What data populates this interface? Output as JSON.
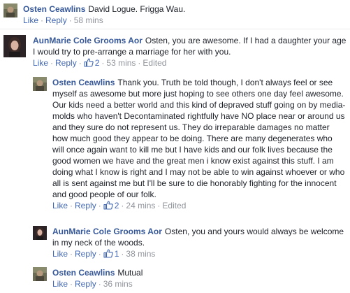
{
  "comments": [
    {
      "author": "Osten Ceawlins",
      "text": "David Logue. Frigga Wau.",
      "actions": {
        "like": "Like",
        "reply": "Reply",
        "time": "58 mins"
      }
    },
    {
      "author": "AunMarie Cole Grooms Aor",
      "text": "Osten, you are awesome. If I had a daughter your age I would try to pre-arrange a marriage for her with you.",
      "actions": {
        "like": "Like",
        "reply": "Reply",
        "likes": "2",
        "time": "53 mins",
        "edited": "Edited"
      }
    },
    {
      "author": "Osten Ceawlins",
      "text": "Thank you. Truth be told though, I don't always feel or see myself as awesome but more just hoping to see others one day feel awesome. Our kids need a better world and this kind of depraved stuff going on by media-molds who haven't Decontaminated rightfully have NO place near or around us and they sure do not represent us. They do irreparable damages no matter how much good they appear to be doing. There are many degenerates who will once again want to kill me but I have kids and our folk lives because the good women we have and the great men i know exist against this stuff. I am doing what I know is right and I may not be able to win against whoever or who all is sent against me but I'll be sure to die honorably fighting for the innocent and good people of our folk.",
      "actions": {
        "like": "Like",
        "reply": "Reply",
        "likes": "2",
        "time": "24 mins",
        "edited": "Edited"
      }
    },
    {
      "author": "AunMarie Cole Grooms Aor",
      "text": "Osten, you and yours would always be welcome in my neck of the woods.",
      "actions": {
        "like": "Like",
        "reply": "Reply",
        "likes": "1",
        "time": "38 mins"
      }
    },
    {
      "author": "Osten Ceawlins",
      "text": "Mutual",
      "actions": {
        "like": "Like",
        "reply": "Reply",
        "time": "36 mins"
      }
    }
  ],
  "colors": {
    "author": "#365899",
    "link": "#4267b2",
    "meta": "#90949c",
    "text": "#1d2129",
    "divider": "#e9ebee"
  },
  "icons": {
    "thumb": "thumbs-up-icon"
  }
}
